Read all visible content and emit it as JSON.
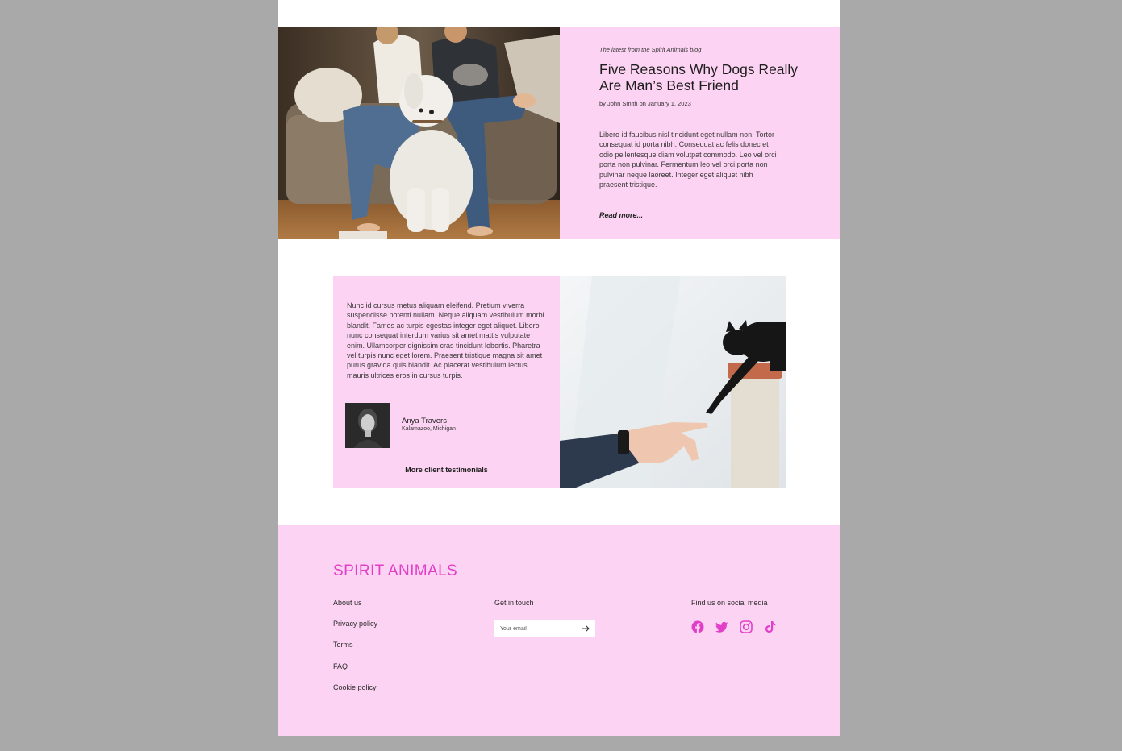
{
  "colors": {
    "backdrop": "#a9a9a9",
    "pink_panel": "#fcd3f2",
    "brand_magenta": "#e23fc8",
    "text_dark": "#1e1e1e"
  },
  "blog": {
    "kicker": "The latest from the Spirit Animals blog",
    "title": "Five Reasons Why Dogs Really Are Man’s Best Friend",
    "byline": "by John Smith on January 1, 2023",
    "excerpt": "Libero id faucibus nisl tincidunt eget nullam non. Tortor consequat id porta nibh. Consequat ac felis donec et odio pellentesque diam volutpat commodo. Leo vel orci porta non pulvinar. Fermentum leo vel orci porta non pulvinar neque laoreet. Integer eget aliquet nibh praesent tristique.",
    "read_more": "Read more..."
  },
  "testimonial": {
    "quote": "Nunc id cursus metus aliquam eleifend. Pretium viverra suspendisse potenti nullam. Neque aliquam vestibulum morbi blandit. Fames ac turpis egestas integer eget aliquet. Libero nunc consequat interdum varius sit amet mattis vulputate enim. Ullamcorper dignissim cras tincidunt lobortis. Pharetra vel turpis nunc eget lorem. Praesent tristique magna sit amet purus gravida quis blandit. Ac placerat vestibulum lectus mauris ultrices eros in cursus turpis.",
    "name": "Anya Travers",
    "location": "Kalamazoo, Michigan",
    "more_link": "More client testimonials"
  },
  "footer": {
    "brand": "SPIRIT ANIMALS",
    "links": [
      "About us",
      "Privacy policy",
      "Terms",
      "FAQ",
      "Cookie policy"
    ],
    "contact_heading": "Get in touch",
    "email_placeholder": "Your email",
    "social_heading": "Find us on social media",
    "social_icons": [
      "facebook-icon",
      "twitter-icon",
      "instagram-icon",
      "tiktok-icon"
    ]
  }
}
